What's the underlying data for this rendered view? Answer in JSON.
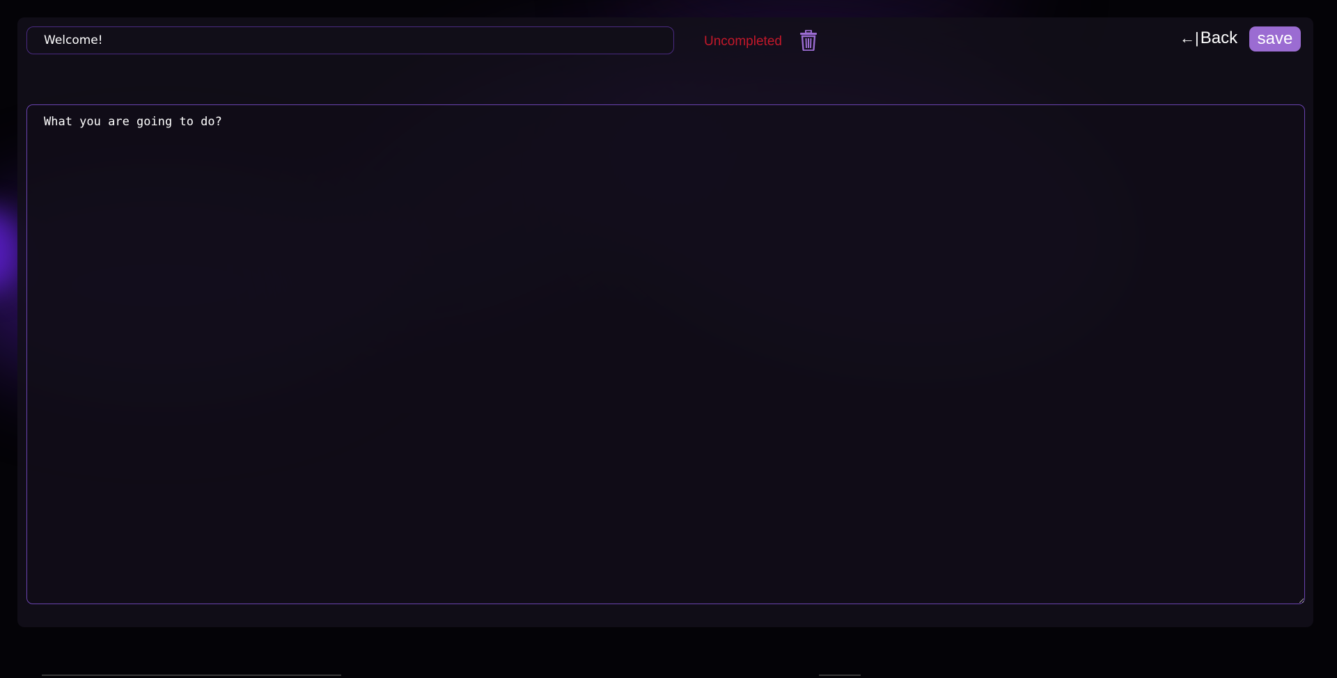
{
  "task": {
    "title_value": "Welcome!",
    "status_label": "Uncompleted",
    "body_text": "What you are going to do?"
  },
  "nav": {
    "back_arrow": "←|",
    "back_label": "Back",
    "save_label": "save"
  },
  "icons": {
    "delete": "trash-icon"
  },
  "colors": {
    "accent": "#9b6cd2",
    "border": "#6a43b0",
    "status_uncompleted": "#c4182a",
    "panel_bg": "#130f1a"
  }
}
